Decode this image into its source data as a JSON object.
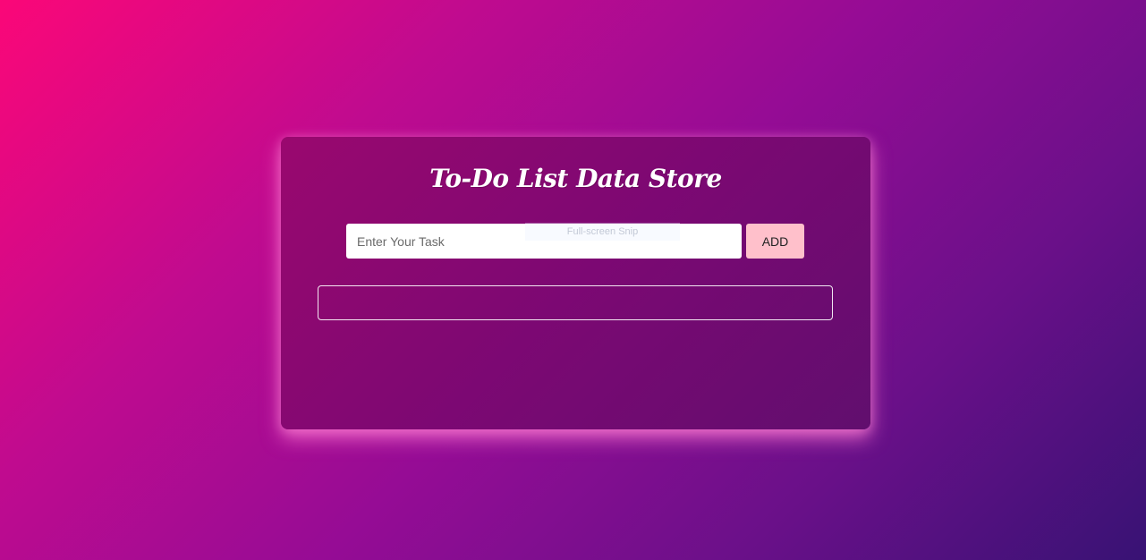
{
  "app": {
    "title": "To-Do List Data Store"
  },
  "form": {
    "input_placeholder": "Enter Your Task",
    "input_value": "",
    "add_label": "ADD"
  },
  "overlay": {
    "snip_hint": "Full-screen Snip"
  },
  "tasks": [],
  "colors": {
    "background_start": "#fb0778",
    "background_end": "#381274",
    "card": "#7a0870",
    "button": "#ffc0cb",
    "title_text": "#ffffff"
  }
}
